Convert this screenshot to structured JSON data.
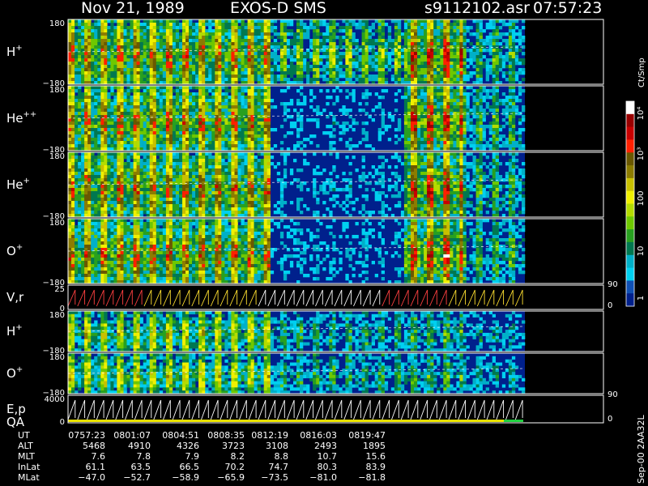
{
  "header": {
    "date": "Nov 21, 1989",
    "mission": "EXOS-D SMS",
    "file": "s9112102.asr",
    "time": "07:57:23"
  },
  "chart_data": [
    {
      "type": "heatmap",
      "panel": "H+",
      "label": "H",
      "charge": "+",
      "ylim": [
        -180,
        180
      ],
      "ticks": [
        "180",
        "−180"
      ]
    },
    {
      "type": "heatmap",
      "panel": "He++",
      "label": "He",
      "charge": "++",
      "ylim": [
        -180,
        180
      ],
      "ticks": [
        "180",
        "−180"
      ]
    },
    {
      "type": "heatmap",
      "panel": "He+",
      "label": "He",
      "charge": "+",
      "ylim": [
        -180,
        180
      ],
      "ticks": [
        "180",
        "−180"
      ]
    },
    {
      "type": "heatmap",
      "panel": "O+",
      "label": "O",
      "charge": "+",
      "ylim": [
        -180,
        180
      ],
      "ticks": [
        "180",
        "−180"
      ]
    },
    {
      "type": "line",
      "panel": "V,r",
      "label": "V,r",
      "ticks": [
        "25",
        "0"
      ],
      "right_ticks": [
        "90",
        "0"
      ]
    },
    {
      "type": "heatmap",
      "panel": "H+ (2)",
      "label": "H",
      "charge": "+",
      "ylim": [
        -180,
        180
      ],
      "ticks": [
        "180",
        "−180"
      ]
    },
    {
      "type": "heatmap",
      "panel": "O+ (2)",
      "label": "O",
      "charge": "+",
      "ylim": [
        -180,
        180
      ],
      "ticks": [
        "180",
        "−180"
      ]
    },
    {
      "type": "line",
      "panel": "E,p",
      "label": "E,p",
      "label2": "QA",
      "ticks": [
        "4000",
        "0"
      ],
      "right_ticks": [
        "90",
        "0"
      ]
    }
  ],
  "colorbar": {
    "unit": "Ct/Smp",
    "labels": [
      "10⁴",
      "10³",
      "100",
      "10",
      "1"
    ],
    "colors": [
      "#ffffff",
      "#9a0000",
      "#c80000",
      "#ff2000",
      "#6a5800",
      "#8c7c00",
      "#c8c000",
      "#f0f000",
      "#b4dc00",
      "#6ec800",
      "#28a020",
      "#007850",
      "#00b0c8",
      "#00d0f0",
      "#1050b4",
      "#00208c"
    ]
  },
  "footer": {
    "row_labels": [
      "UT",
      "ALT",
      "MLT",
      "InLat",
      "MLat"
    ],
    "columns": [
      [
        "0757:23",
        "5468",
        "7.6",
        "61.1",
        "−47.0"
      ],
      [
        "0801:07",
        "4910",
        "7.8",
        "63.5",
        "−52.7"
      ],
      [
        "0804:51",
        "4326",
        "7.9",
        "66.5",
        "−58.9"
      ],
      [
        "0808:35",
        "3723",
        "8.2",
        "70.2",
        "−65.9"
      ],
      [
        "0812:19",
        "3108",
        "8.8",
        "74.7",
        "−73.5"
      ],
      [
        "0816:03",
        "2493",
        "10.7",
        "80.3",
        "−81.0"
      ],
      [
        "0819:47",
        "1895",
        "15.6",
        "83.9",
        "−81.8"
      ]
    ]
  },
  "stamp": "Sep-00 2AA32L"
}
